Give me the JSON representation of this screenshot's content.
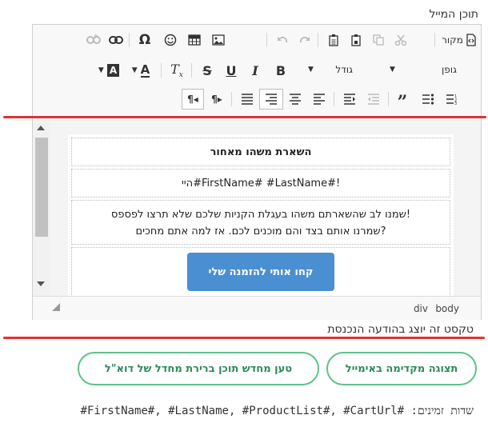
{
  "section_label": "תוכן המייל",
  "toolbar": {
    "source_label": "מקור",
    "font_label": "גופן",
    "size_label": "גודל",
    "icons": [
      "source-icon",
      "cut-icon",
      "copy-icon",
      "paste-icon",
      "paste-text-icon",
      "undo-icon",
      "redo-icon",
      "image-icon",
      "table-icon",
      "smiley-icon",
      "omega-icon",
      "link-icon",
      "unlink-icon",
      "bold-icon",
      "italic-icon",
      "underline-icon",
      "strike-icon",
      "remove-format-icon",
      "text-color-icon",
      "bg-color-icon",
      "numbered-list-icon",
      "bulleted-list-icon",
      "blockquote-icon",
      "outdent-icon",
      "indent-icon",
      "align-left-icon",
      "align-center-icon",
      "align-right-icon",
      "justify-icon",
      "ltr-icon",
      "rtl-icon"
    ]
  },
  "content": {
    "heading": "השארת משהו מאחור",
    "greeting": "היי#FirstName# #LastName#!",
    "body_line1": "שמנו לב שהשארתם משהו בעגלת הקניות שלכם שלא תרצו לפספס!",
    "body_line2": "שמרנו אותם בצד והם מוכנים לכם. אז למה אתם מחכים?",
    "cta_label": "קחו אותי להזמנה שלי",
    "cta_color": "#4a8fd1"
  },
  "statusbar": {
    "path1": "body",
    "path2": "div"
  },
  "note": "טקסט זה יוצג בהודעה הנכנסת",
  "buttons": {
    "preview_label": "תצוגה מקדימה באימייל",
    "reload_label": "טען מחדש תוכן ברירת מחדל של דוא\"ל",
    "accent": "#5cc28a"
  },
  "fields_text": "שדות זמינים: #FirstName#, #LastName, #ProductList#, #CartUrl#",
  "highlight_color": "#e53030"
}
